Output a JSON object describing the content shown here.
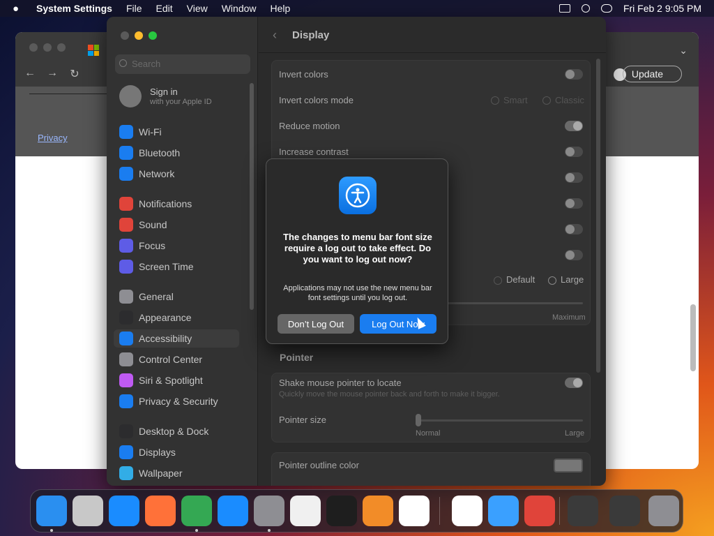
{
  "menubar": {
    "apple": "",
    "app_name": "System Settings",
    "menus": [
      "File",
      "Edit",
      "View",
      "Window",
      "Help"
    ],
    "datetime": "Fri Feb 2  9:05 PM"
  },
  "browser": {
    "privacy_link": "Privacy",
    "update_label": "Update"
  },
  "settings": {
    "search_placeholder": "Search",
    "signin": {
      "title": "Sign in",
      "subtitle": "with your Apple ID"
    },
    "sidebar": [
      {
        "label": "Wi-Fi",
        "icon": "wifi-icon",
        "color": "#1a7df0"
      },
      {
        "label": "Bluetooth",
        "icon": "bluetooth-icon",
        "color": "#1a7df0"
      },
      {
        "label": "Network",
        "icon": "globe-icon",
        "color": "#1a7df0"
      },
      {
        "label": "Notifications",
        "icon": "bell-icon",
        "color": "#e0443a"
      },
      {
        "label": "Sound",
        "icon": "speaker-icon",
        "color": "#e0443a"
      },
      {
        "label": "Focus",
        "icon": "moon-icon",
        "color": "#5e5ce6"
      },
      {
        "label": "Screen Time",
        "icon": "hourglass-icon",
        "color": "#5e5ce6"
      },
      {
        "label": "General",
        "icon": "gear-icon",
        "color": "#8e8e93"
      },
      {
        "label": "Appearance",
        "icon": "appearance-icon",
        "color": "#2c2c2e"
      },
      {
        "label": "Accessibility",
        "icon": "accessibility-icon",
        "color": "#1a7df0"
      },
      {
        "label": "Control Center",
        "icon": "control-center-icon",
        "color": "#8e8e93"
      },
      {
        "label": "Siri & Spotlight",
        "icon": "siri-icon",
        "color": "#bf5af2"
      },
      {
        "label": "Privacy & Security",
        "icon": "hand-icon",
        "color": "#1a7df0"
      },
      {
        "label": "Desktop & Dock",
        "icon": "dock-icon",
        "color": "#2c2c2e"
      },
      {
        "label": "Displays",
        "icon": "display-icon",
        "color": "#1a7df0"
      },
      {
        "label": "Wallpaper",
        "icon": "wallpaper-icon",
        "color": "#32ade6"
      }
    ],
    "selected": "Accessibility",
    "header": {
      "back": "‹",
      "title": "Display"
    },
    "rows": {
      "invert_colors": "Invert colors",
      "invert_mode": "Invert colors mode",
      "invert_smart": "Smart",
      "invert_classic": "Classic",
      "reduce_motion": "Reduce motion",
      "increase_contrast": "Increase contrast",
      "menu_default": "Default",
      "menu_large": "Large",
      "maximum": "Maximum",
      "pointer_section": "Pointer",
      "shake_title": "Shake mouse pointer to locate",
      "shake_desc": "Quickly move the mouse pointer back and forth to make it bigger.",
      "pointer_size": "Pointer size",
      "normal": "Normal",
      "large": "Large",
      "pointer_outline": "Pointer outline color"
    },
    "toggles": {
      "invert_colors": false,
      "reduce_motion": true,
      "increase_contrast": false,
      "shake_mouse": true
    }
  },
  "dialog": {
    "icon": "accessibility-icon",
    "title": "The changes to menu bar font size require a log out to take effect. Do you want to log out now?",
    "message": "Applications may not use the new menu bar font settings until you log out.",
    "secondary_button": "Don’t Log Out",
    "primary_button": "Log Out Now"
  },
  "dock": [
    {
      "name": "finder-icon",
      "color": "#2a8ff0",
      "running": true
    },
    {
      "name": "launchpad-icon",
      "color": "#c8c8c8",
      "running": false
    },
    {
      "name": "safari-icon",
      "color": "#1a8cff",
      "running": false
    },
    {
      "name": "firefox-icon",
      "color": "#ff7139",
      "running": false
    },
    {
      "name": "chrome-icon",
      "color": "#34a853",
      "running": true
    },
    {
      "name": "app-store-icon",
      "color": "#1a8cff",
      "running": false
    },
    {
      "name": "system-settings-icon",
      "color": "#8e8e93",
      "running": true
    },
    {
      "name": "textedit-icon",
      "color": "#f0f0f0",
      "running": false
    },
    {
      "name": "terminal-icon",
      "color": "#1e1e1e",
      "running": false
    },
    {
      "name": "garageband-icon",
      "color": "#f28c28",
      "running": false
    },
    {
      "name": "vscode-icon",
      "color": "#ffffff",
      "running": false
    },
    {
      "name": "visual-studio-icon",
      "color": "#ffffff",
      "running": false
    },
    {
      "name": "icloud-icon",
      "color": "#3aa0ff",
      "running": false
    },
    {
      "name": "photo-booth-icon",
      "color": "#e0443a",
      "running": false
    },
    {
      "name": "minimized-window-icon",
      "color": "#3a3a3a",
      "running": false
    },
    {
      "name": "minimized-window-icon",
      "color": "#3a3a3a",
      "running": false
    },
    {
      "name": "trash-icon",
      "color": "#8e8e93",
      "running": false
    }
  ]
}
